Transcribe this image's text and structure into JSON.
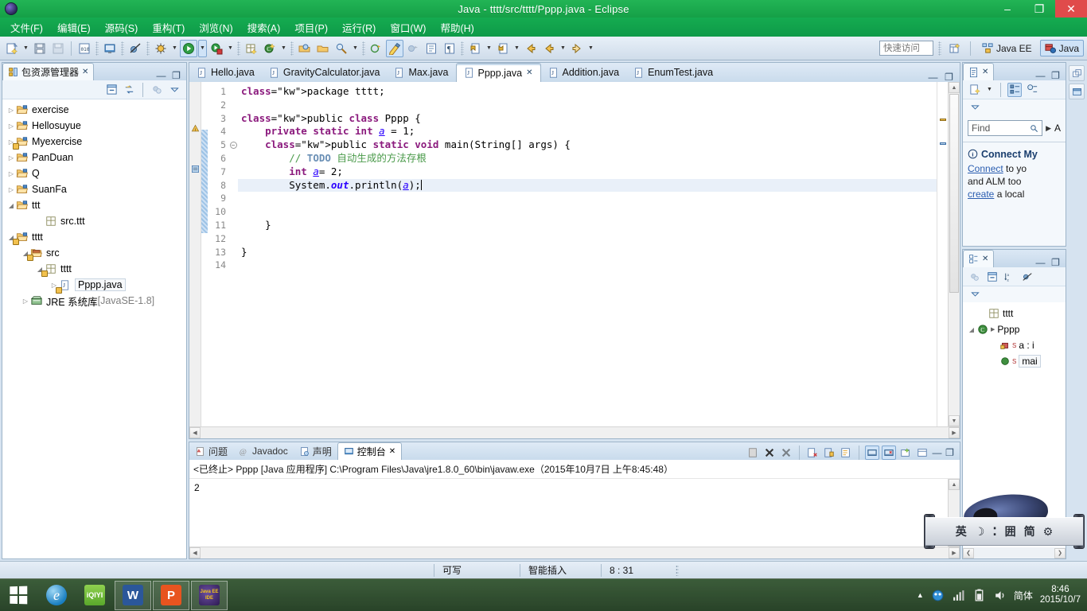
{
  "window": {
    "title": "Java - tttt/src/tttt/Pppp.java - Eclipse",
    "minimize": "–",
    "restore": "❐",
    "close": "✕",
    "app_icon": "eclipse-icon"
  },
  "menubar": {
    "items": [
      {
        "label": "文件(F)"
      },
      {
        "label": "编辑(E)"
      },
      {
        "label": "源码(S)"
      },
      {
        "label": "重构(T)"
      },
      {
        "label": "浏览(N)"
      },
      {
        "label": "搜索(A)"
      },
      {
        "label": "项目(P)"
      },
      {
        "label": "运行(R)"
      },
      {
        "label": "窗口(W)"
      },
      {
        "label": "帮助(H)"
      }
    ]
  },
  "toolbar": {
    "quick_access_placeholder": "快速访问",
    "quick_access_value": "",
    "perspectives": [
      {
        "label": "Java EE",
        "active": false
      },
      {
        "label": "Java",
        "active": true
      }
    ],
    "open_perspective_icon": "open-perspective-icon"
  },
  "package_explorer": {
    "tab_label": "包资源管理器",
    "close_label": "✕",
    "minimize_label": "—",
    "maximize_label": "❐",
    "tools": [
      "collapse-all-icon",
      "link-with-editor-icon",
      "focus-icon",
      "view-menu-icon"
    ],
    "tree": [
      {
        "indent": 0,
        "twisty": "▷",
        "icon": "project-folder-icon",
        "label": "exercise",
        "warn": false
      },
      {
        "indent": 0,
        "twisty": "▷",
        "icon": "project-folder-icon",
        "label": "Hellosuyue",
        "warn": false
      },
      {
        "indent": 0,
        "twisty": "▷",
        "icon": "project-folder-icon",
        "label": "Myexercise",
        "warn": true
      },
      {
        "indent": 0,
        "twisty": "▷",
        "icon": "project-folder-icon",
        "label": "PanDuan",
        "warn": false
      },
      {
        "indent": 0,
        "twisty": "▷",
        "icon": "project-folder-icon",
        "label": "Q",
        "warn": false
      },
      {
        "indent": 0,
        "twisty": "▷",
        "icon": "project-folder-icon",
        "label": "SuanFa",
        "warn": false
      },
      {
        "indent": 0,
        "twisty": "◢",
        "icon": "project-folder-icon",
        "label": "ttt",
        "warn": false
      },
      {
        "indent": 2,
        "twisty": "",
        "icon": "package-icon",
        "label": "src.ttt",
        "warn": false
      },
      {
        "indent": 0,
        "twisty": "◢",
        "icon": "project-folder-icon",
        "label": "tttt",
        "warn": true
      },
      {
        "indent": 1,
        "twisty": "◢",
        "icon": "source-folder-icon",
        "label": "src",
        "warn": true
      },
      {
        "indent": 2,
        "twisty": "◢",
        "icon": "package-icon",
        "label": "tttt",
        "warn": true
      },
      {
        "indent": 3,
        "twisty": "▷",
        "icon": "java-file-icon",
        "label": "Pppp.java",
        "warn": true,
        "selected": true
      },
      {
        "indent": 1,
        "twisty": "▷",
        "icon": "jre-library-icon",
        "label": "JRE 系统库",
        "suffix": "[JavaSE-1.8]",
        "warn": false
      }
    ]
  },
  "editor": {
    "tabs": [
      {
        "label": "Hello.java",
        "active": false,
        "warn": false
      },
      {
        "label": "GravityCalculator.java",
        "active": false,
        "warn": false
      },
      {
        "label": "Max.java",
        "active": false,
        "warn": false
      },
      {
        "label": "Pppp.java",
        "active": true,
        "warn": true,
        "close": "✕"
      },
      {
        "label": "Addition.java",
        "active": false,
        "warn": false
      },
      {
        "label": "EnumTest.java",
        "active": false,
        "warn": false
      }
    ],
    "minimize_label": "—",
    "maximize_label": "❐",
    "lines": [
      {
        "n": 1,
        "text": "package tttt;"
      },
      {
        "n": 2,
        "text": ""
      },
      {
        "n": 3,
        "text": "public class Pppp {"
      },
      {
        "n": 4,
        "text": "    private static int a = 1;"
      },
      {
        "n": 5,
        "text": "    public static void main(String[] args) {"
      },
      {
        "n": 6,
        "text": "        // TODO 自动生成的方法存根"
      },
      {
        "n": 7,
        "text": "        int a= 2;"
      },
      {
        "n": 8,
        "text": "        System.out.println(a);"
      },
      {
        "n": 9,
        "text": ""
      },
      {
        "n": 10,
        "text": ""
      },
      {
        "n": 11,
        "text": "    }"
      },
      {
        "n": 12,
        "text": ""
      },
      {
        "n": 13,
        "text": "}"
      },
      {
        "n": 14,
        "text": ""
      }
    ],
    "cursor_line": 8
  },
  "console": {
    "tabs": [
      {
        "label": "问题",
        "icon": "problems-icon",
        "active": false
      },
      {
        "label": "Javadoc",
        "icon": "javadoc-icon",
        "active": false
      },
      {
        "label": "声明",
        "icon": "declaration-icon",
        "active": false
      },
      {
        "label": "控制台",
        "icon": "console-icon",
        "active": true,
        "close": "✕"
      }
    ],
    "tools": [
      "clear-console-icon",
      "terminate-icon",
      "remove-all-terminated-icon",
      "display-selected-console-icon",
      "scroll-lock-icon",
      "pin-console-icon",
      "show-console-on-output-icon",
      "show-console-on-error-icon",
      "open-console-icon",
      "display-console-icon"
    ],
    "minimize_label": "—",
    "maximize_label": "❐",
    "header": "<已终止> Pppp [Java 应用程序] C:\\Program Files\\Java\\jre1.8.0_60\\bin\\javaw.exe（2015年10月7日 上午8:45:48）",
    "output": "2"
  },
  "task_list": {
    "tab_label": "",
    "tab_icon": "task-list-icon",
    "close_label": "✕",
    "minimize_label": "—",
    "maximize_label": "❐",
    "tools": [
      "new-task-icon",
      "categorized-mode-icon",
      "scheduled-mode-icon",
      "view-menu-icon"
    ],
    "find_placeholder": "Find",
    "find_value": "",
    "find_icon": "search-icon",
    "filter_arrow": "▶",
    "filter_label": "A",
    "info_icon": "info-icon",
    "connect_title": "Connect My",
    "connect_line1_link": "Connect",
    "connect_line1_rest": " to yo",
    "connect_line2": "and ALM too",
    "connect_line3_link": "create",
    "connect_line3_rest": " a local"
  },
  "outline": {
    "tab_icon": "outline-icon",
    "close_label": "✕",
    "minimize_label": "—",
    "maximize_label": "❐",
    "tools": [
      "focus-icon",
      "collapse-all-icon",
      "sort-icon",
      "hide-fields-icon",
      "view-menu-icon"
    ],
    "items": [
      {
        "indent": 1,
        "twisty": "",
        "icon": "package-icon",
        "label": "tttt",
        "badge": ""
      },
      {
        "indent": 0,
        "twisty": "◢",
        "icon": "class-icon",
        "label": "Pppp",
        "badge": "",
        "trailing": "▶"
      },
      {
        "indent": 2,
        "twisty": "",
        "icon": "private-field-icon",
        "label": "a : i",
        "badge": "S"
      },
      {
        "indent": 2,
        "twisty": "",
        "icon": "public-method-icon",
        "label": "mai",
        "badge": "S",
        "selected": true
      }
    ],
    "scroll_left": "❮",
    "scroll_right": "❯"
  },
  "far_right": {
    "buttons": [
      "restore-icon",
      "minimize-view-icon"
    ]
  },
  "statusbar": {
    "writable": "可写",
    "insert_mode": "智能插入",
    "position": "8 : 31"
  },
  "ime": {
    "items": [
      "英",
      "☽",
      "⁚",
      "囲",
      "简",
      "⚙"
    ],
    "mascot": "mascot-icon"
  },
  "taskbar": {
    "start_label": "start-button",
    "apps": [
      {
        "name": "internet-explorer-icon",
        "label": "e",
        "open": false
      },
      {
        "name": "iqiyi-icon",
        "label": "iQIYI",
        "open": false
      },
      {
        "name": "wps-writer-icon",
        "label": "W",
        "open": true
      },
      {
        "name": "wps-presentation-icon",
        "label": "P",
        "open": true
      },
      {
        "name": "eclipse-java-ee-icon",
        "label": "Java EE IDE",
        "open": true
      }
    ],
    "tray": {
      "expand": "▲",
      "icons": [
        "security-icon",
        "network-icon",
        "battery-icon",
        "volume-icon"
      ],
      "language": "简体",
      "time": "8:46",
      "date": "2015/10/7"
    }
  },
  "colors": {
    "titlebar_green": "#16a34a",
    "accent_blue": "#2a5db0",
    "keyword": "#8b1a7d",
    "comment": "#4a9a4a",
    "field": "#2a00ff",
    "selection": "#e9f0f9"
  }
}
